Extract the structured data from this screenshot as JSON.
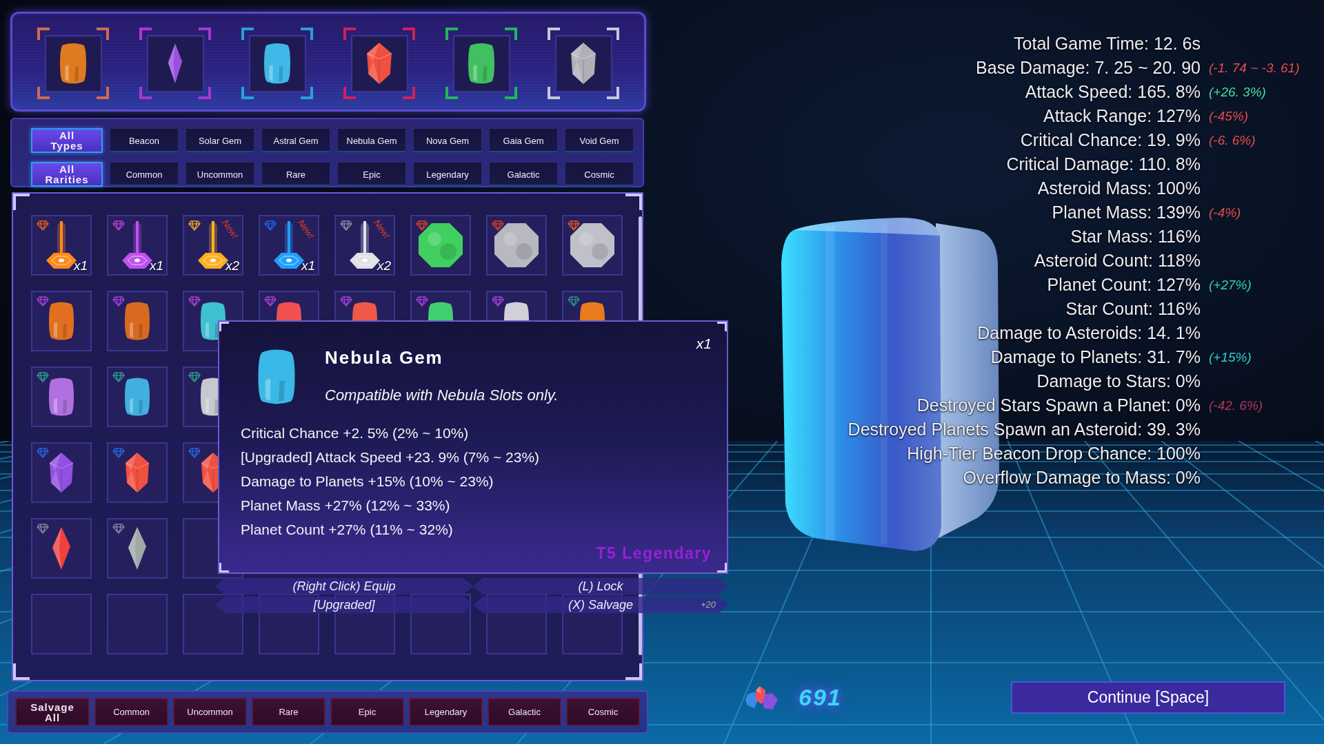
{
  "equipped_slots": [
    {
      "kind": "cylinder",
      "color": "#d06a50",
      "gem": {
        "color": "#e07a20"
      }
    },
    {
      "kind": "shard",
      "color": "#a838d0",
      "gem": {
        "color": "#9a50e0"
      }
    },
    {
      "kind": "cylinder",
      "color": "#28a0d8",
      "gem": {
        "color": "#40b8e8"
      }
    },
    {
      "kind": "crystal",
      "color": "#d0205a",
      "gem": {
        "color": "#f05040"
      }
    },
    {
      "kind": "cylinder",
      "color": "#20b858",
      "gem": {
        "color": "#40c060"
      }
    },
    {
      "kind": "crystal",
      "color": "#c8c8d8",
      "gem": {
        "color": "#b0b0b8"
      }
    }
  ],
  "type_filters": [
    {
      "label": "All Types",
      "kind": "all",
      "selected": true
    },
    {
      "label": "Beacon",
      "kind": "single",
      "selected": false
    },
    {
      "label": "Solar Gem",
      "kind": "single",
      "selected": false
    },
    {
      "label": "Astral Gem",
      "kind": "single",
      "selected": false
    },
    {
      "label": "Nebula Gem",
      "kind": "single",
      "selected": false
    },
    {
      "label": "Nova Gem",
      "kind": "single",
      "selected": false
    },
    {
      "label": "Gaia Gem",
      "kind": "single",
      "selected": false
    },
    {
      "label": "Void Gem",
      "kind": "single",
      "selected": false
    }
  ],
  "rarity_filters": [
    {
      "label": "All Rarities",
      "kind": "all",
      "selected": true
    },
    {
      "label": "Common",
      "kind": "single",
      "selected": false
    },
    {
      "label": "Uncommon",
      "kind": "single",
      "selected": false
    },
    {
      "label": "Rare",
      "kind": "single",
      "selected": false
    },
    {
      "label": "Epic",
      "kind": "single",
      "selected": false
    },
    {
      "label": "Legendary",
      "kind": "single",
      "selected": false
    },
    {
      "label": "Galactic",
      "kind": "single",
      "selected": false
    },
    {
      "label": "Cosmic",
      "kind": "single",
      "selected": false
    }
  ],
  "inventory": {
    "rows": [
      {
        "cells": [
          {
            "kind": "beacon",
            "rarity": {
              "color": "#e0581a"
            },
            "gem": {
              "color": "#ff8a1a"
            },
            "count": "x1"
          },
          {
            "kind": "beacon",
            "rarity": {
              "color": "#b040d0"
            },
            "gem": {
              "color": "#c050f0"
            },
            "count": "x1"
          },
          {
            "kind": "beacon",
            "rarity": {
              "color": "#e8a020"
            },
            "gem": {
              "color": "#ffb020"
            },
            "count": "x2",
            "badge": "New!"
          },
          {
            "kind": "beacon",
            "rarity": {
              "color": "#2060e0"
            },
            "gem": {
              "color": "#20a0ff"
            },
            "count": "x1",
            "badge": "New!"
          },
          {
            "kind": "beacon",
            "rarity": {
              "color": "#8a8a9a"
            },
            "gem": {
              "color": "#e0e0e8"
            },
            "count": "x2",
            "badge": "New!"
          },
          {
            "kind": "round",
            "rarity": {
              "color": "#d04020"
            },
            "gem": {
              "color": "#40d060"
            }
          },
          {
            "kind": "round",
            "rarity": {
              "color": "#d04020"
            },
            "gem": {
              "color": "#b8b8c0"
            }
          },
          {
            "kind": "round",
            "rarity": {
              "color": "#e05020"
            },
            "gem": {
              "color": "#c0c0c8"
            }
          }
        ]
      },
      {
        "cells": [
          {
            "kind": "cylinder",
            "rarity": {
              "color": "#a040d0"
            },
            "gem": {
              "color": "#e07020"
            }
          },
          {
            "kind": "cylinder",
            "rarity": {
              "color": "#a040d0"
            },
            "gem": {
              "color": "#d86a20"
            }
          },
          {
            "kind": "cylinder",
            "rarity": {
              "color": "#a040d0"
            },
            "gem": {
              "color": "#40c0d0"
            }
          },
          {
            "kind": "cylinder",
            "rarity": {
              "color": "#a040d0"
            },
            "gem": {
              "color": "#f05050"
            }
          },
          {
            "kind": "cylinder",
            "rarity": {
              "color": "#a040d0"
            },
            "gem": {
              "color": "#f05848"
            }
          },
          {
            "kind": "cylinder",
            "rarity": {
              "color": "#a040d0"
            },
            "gem": {
              "color": "#40d070"
            }
          },
          {
            "kind": "cylinder",
            "rarity": {
              "color": "#a040d0"
            },
            "gem": {
              "color": "#d0d0d8"
            }
          },
          {
            "kind": "cylinder",
            "rarity": {
              "color": "#2a8a8a"
            },
            "gem": {
              "color": "#e87a20"
            }
          }
        ]
      },
      {
        "cells": [
          {
            "kind": "cylinder",
            "rarity": {
              "color": "#2a9a8a"
            },
            "gem": {
              "color": "#b070e0"
            }
          },
          {
            "kind": "cylinder",
            "rarity": {
              "color": "#2a9a8a"
            },
            "gem": {
              "color": "#40b0e0"
            }
          },
          {
            "kind": "cylinder",
            "rarity": {
              "color": "#2a9a8a"
            },
            "gem": {
              "color": "#c8c8d0"
            }
          }
        ]
      },
      {
        "cells": [
          {
            "kind": "crystal",
            "rarity": {
              "color": "#2a60d8"
            },
            "gem": {
              "color": "#9050e0"
            }
          },
          {
            "kind": "crystal",
            "rarity": {
              "color": "#2a60d8"
            },
            "gem": {
              "color": "#f05040"
            }
          },
          {
            "kind": "crystal",
            "rarity": {
              "color": "#2a60d8"
            },
            "gem": {
              "color": "#f05040"
            }
          }
        ]
      },
      {
        "cells": [
          {
            "kind": "shard",
            "rarity": {
              "color": "#8080a0"
            },
            "gem": {
              "color": "#f04040"
            }
          },
          {
            "kind": "shard",
            "rarity": {
              "color": "#8080a0"
            },
            "gem": {
              "color": "#a0a8a8"
            }
          },
          {
            "kind": "empty"
          }
        ]
      },
      {
        "cells": [
          {
            "kind": "empty"
          },
          {
            "kind": "empty"
          },
          {
            "kind": "empty"
          },
          {
            "kind": "empty"
          },
          {
            "kind": "empty"
          },
          {
            "kind": "empty"
          },
          {
            "kind": "empty"
          },
          {
            "kind": "empty"
          }
        ]
      }
    ]
  },
  "tooltip": {
    "title": "Nebula Gem",
    "count": "x1",
    "description": "Compatible with Nebula Slots only.",
    "stats": [
      "Critical Chance +2. 5% (2% ~ 10%)",
      "[Upgraded] Attack Speed +23. 9% (7% ~ 23%)",
      "Damage to Planets +15% (10% ~ 23%)",
      "Planet Mass +27% (12% ~ 33%)",
      "Planet Count +27% (11% ~ 32%)"
    ],
    "tier": "T5 Legendary"
  },
  "action_hints": [
    {
      "left": "(Right Click) Equip",
      "right": "(L) Lock"
    },
    {
      "left": "[Upgraded]",
      "right": "(X) Salvage",
      "bonus": "+20"
    }
  ],
  "salvage_buttons": [
    {
      "label": "Salvage All",
      "kind": "all"
    },
    {
      "label": "Common",
      "kind": "rarity"
    },
    {
      "label": "Uncommon",
      "kind": "rarity"
    },
    {
      "label": "Rare",
      "kind": "rarity"
    },
    {
      "label": "Epic",
      "kind": "rarity"
    },
    {
      "label": "Legendary",
      "kind": "rarity"
    },
    {
      "label": "Galactic",
      "kind": "rarity"
    },
    {
      "label": "Cosmic",
      "kind": "rarity"
    }
  ],
  "stats": [
    {
      "label": "Total Game Time: 12. 6s"
    },
    {
      "label": "Base Damage: 7. 25 ~ 20. 90",
      "change": "(-1. 74 ~ -3. 61)",
      "color": "#e84a4a"
    },
    {
      "label": "Attack Speed: 165. 8%",
      "change": "(+26. 3%)",
      "color": "#40e0a0"
    },
    {
      "label": "Attack Range: 127%",
      "change": "(-45%)",
      "color": "#e84a4a"
    },
    {
      "label": "Critical Chance: 19. 9%",
      "change": "(-6. 6%)",
      "color": "#e84a4a"
    },
    {
      "label": "Critical Damage: 110. 8%"
    },
    {
      "label": "Asteroid Mass: 100%"
    },
    {
      "label": "Planet Mass: 139%",
      "change": "(-4%)",
      "color": "#e84a4a"
    },
    {
      "label": "Star Mass: 116%"
    },
    {
      "label": "Asteroid Count: 118%"
    },
    {
      "label": "Planet Count: 127%",
      "change": "(+27%)",
      "color": "#30d0b8"
    },
    {
      "label": "Star Count: 116%"
    },
    {
      "label": "Damage to Asteroids: 14. 1%"
    },
    {
      "label": "Damage to Planets: 31. 7%",
      "change": "(+15%)",
      "color": "#30d0c8"
    },
    {
      "label": "Damage to Stars: 0%"
    },
    {
      "label": "Destroyed Stars Spawn a Planet: 0%",
      "change": "(-42. 6%)",
      "color": "#b03858"
    },
    {
      "label": "Destroyed Planets Spawn an Asteroid: 39. 3%"
    },
    {
      "label": "High-Tier Beacon Drop Chance: 100%"
    },
    {
      "label": "Overflow Damage to Mass: 0%"
    }
  ],
  "currency": {
    "amount": "691"
  },
  "continue_button": {
    "label": "Continue [Space]"
  }
}
